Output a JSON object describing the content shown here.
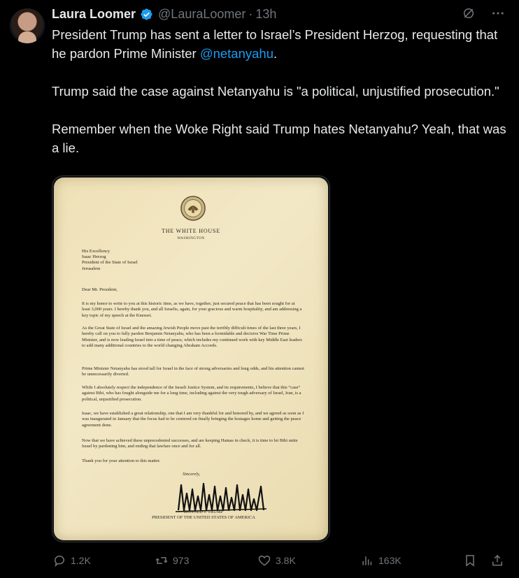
{
  "author": {
    "name": "Laura Loomer",
    "handle": "@LauraLoomer",
    "dot": "·",
    "time": "13h"
  },
  "tweet": {
    "line1": "President Trump has sent a letter to Israel’s President Herzog, requesting that he pardon Prime Minister ",
    "mention": "@netanyahu",
    "line1_end": ".",
    "para2": "Trump said the case against Netanyahu is \"a political, unjustified prosecution.\"",
    "para3": "Remember when the Woke Right said Trump hates Netanyahu? Yeah, that was a lie."
  },
  "letter": {
    "title": "THE WHITE HOUSE",
    "subtitle": "WASHINGTON",
    "address": [
      "His Excellency",
      "Isaac Herzog",
      "President of the State of Israel",
      "Jerusalem"
    ],
    "salutation": "Dear Mr. President,",
    "paragraphs": [
      "It is my honor to write to you at this historic time, as we have, together, just secured peace that has been sought for at least 3,000 years. I hereby thank you, and all Israelis, again, for your gracious and warm hospitality, and am addressing a key topic of my speech at the Knesset.",
      "As the Great State of Israel and the amazing Jewish People move past the terribly difficult times of the last three years, I hereby call on you to fully pardon Benjamin Netanyahu, who has been a formidable and decisive War Time Prime Minister, and is now leading Israel into a time of peace, which includes my continued work with key Middle East leaders to add many additional countries to the world changing Abraham Accords.",
      "Prime Minister Netanyahu has stood tall for Israel in the face of strong adversaries and long odds, and his attention cannot be unnecessarily diverted.",
      "While I absolutely respect the independence of the Israeli Justice System, and its requirements, I believe that this “case” against Bibi, who has fought alongside me for a long time, including against the very tough adversary of Israel, Iran, is a political, unjustified prosecution.",
      "Isaac, we have established a great relationship, one that I am very thankful for and honored by, and we agreed as soon as I was inaugurated in January that the focus had to be centered on finally bringing the hostages home and getting the peace agreement done.",
      "Now that we have achieved these unprecedented successes, and are keeping Hamas in check, it is time to let Bibi unite Israel by pardoning him, and ending that lawfare once and for all.",
      "Thank you for your attention to this matter."
    ],
    "closing": "Sincerely,",
    "signer_name": "DONALD J. TRUMP",
    "signer_title": "PRESIDENT OF THE UNITED STATES OF AMERICA"
  },
  "actions": {
    "replies": "1.2K",
    "reposts": "973",
    "likes": "3.8K",
    "views": "163K"
  },
  "colors": {
    "accent": "#1d9bf0",
    "muted": "#71767b",
    "text": "#e7e9ea",
    "background": "#000000",
    "paper": "#f0e3bb"
  },
  "icons": [
    "verified-badge-icon",
    "grok-icon",
    "more-icon",
    "reply-icon",
    "repost-icon",
    "like-icon",
    "views-icon",
    "bookmark-icon",
    "share-icon"
  ]
}
